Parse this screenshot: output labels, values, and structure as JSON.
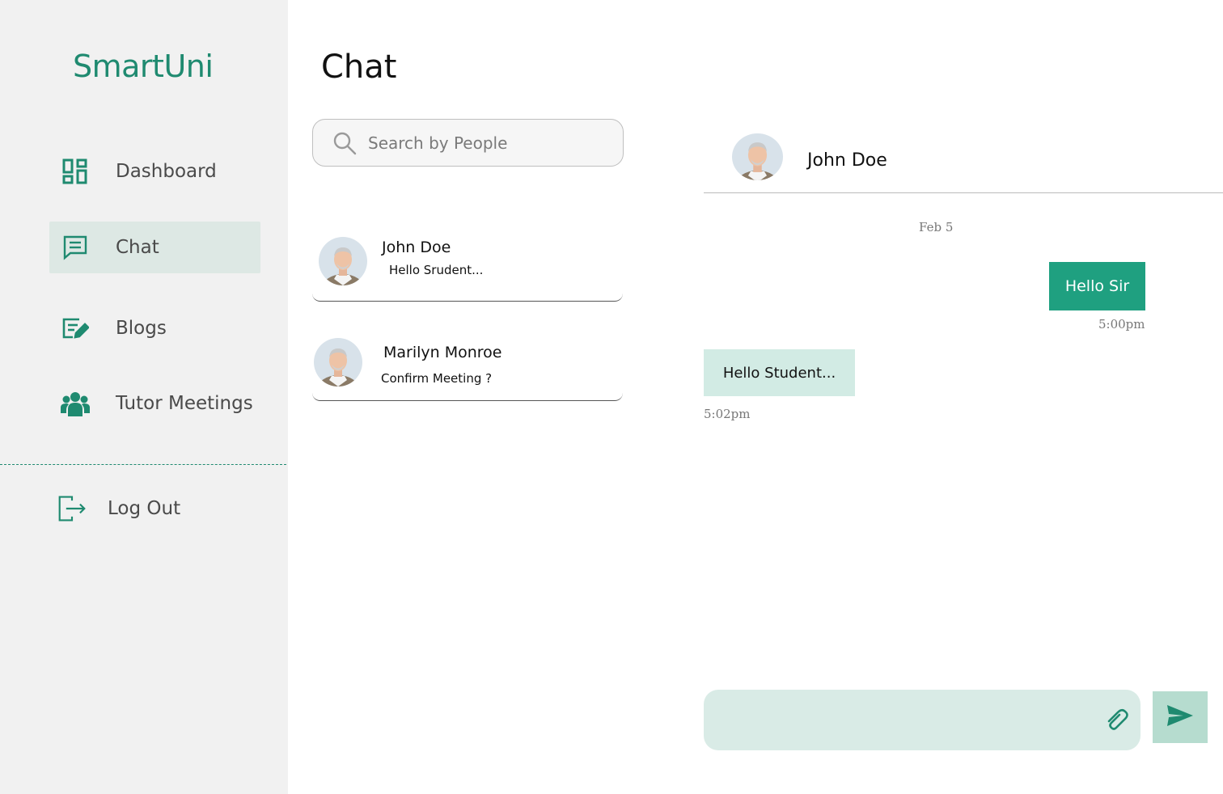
{
  "brand": "SmartUni",
  "sidebar": {
    "items": [
      {
        "label": "Dashboard",
        "icon": "dashboard-icon",
        "active": false
      },
      {
        "label": "Chat",
        "icon": "chat-icon",
        "active": true
      },
      {
        "label": "Blogs",
        "icon": "blog-edit-icon",
        "active": false
      },
      {
        "label": "Tutor Meetings",
        "icon": "group-icon",
        "active": false
      }
    ],
    "logout": {
      "label": "Log Out",
      "icon": "logout-icon"
    }
  },
  "page": {
    "title": "Chat"
  },
  "search": {
    "placeholder": "Search by People",
    "icon": "search-icon"
  },
  "contacts": [
    {
      "name": "John Doe",
      "preview": "Hello Srudent..."
    },
    {
      "name": "Marilyn Monroe",
      "preview": "Confirm Meeting ?"
    }
  ],
  "conversation": {
    "contact_name": "John Doe",
    "date": "Feb 5",
    "messages": [
      {
        "direction": "outgoing",
        "text": "Hello Sir",
        "time": "5:00pm"
      },
      {
        "direction": "incoming",
        "text": "Hello Student...",
        "time": "5:02pm"
      }
    ]
  },
  "composer": {
    "value": "",
    "attach_icon": "paperclip-icon",
    "send_icon": "send-icon"
  },
  "colors": {
    "accent": "#1f8a70",
    "sidebar_bg": "#f1f1f1",
    "active_nav_bg": "#dde8e4",
    "outgoing_bubble": "#1fa080",
    "incoming_bubble": "#d2ebe4",
    "composer_bg": "#d9ebe6",
    "send_button_bg": "#b6dccf"
  }
}
